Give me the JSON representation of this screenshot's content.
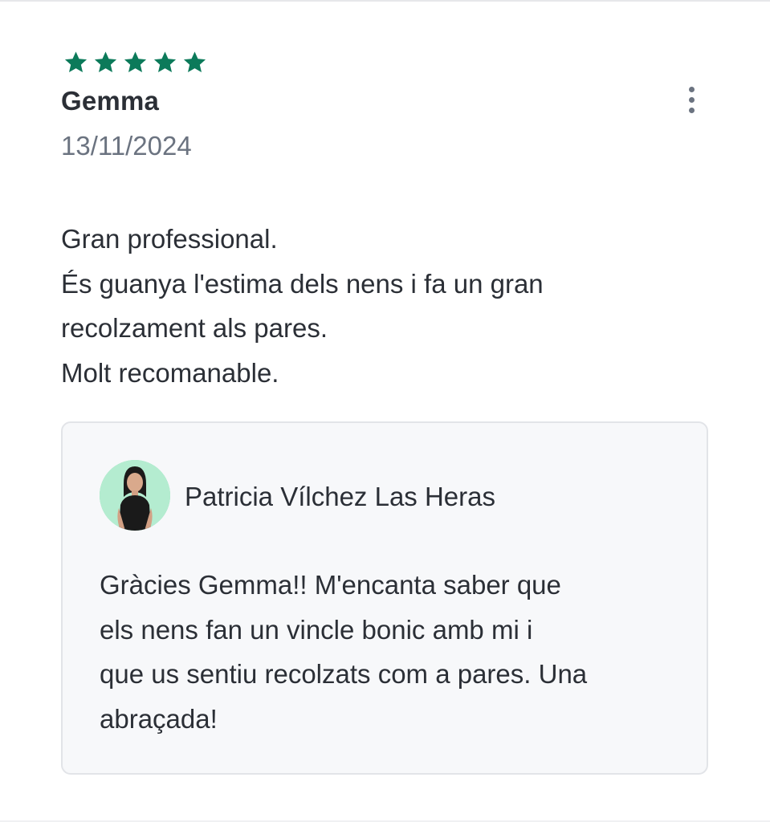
{
  "review": {
    "rating": 5,
    "rating_max": 5,
    "star_color": "#0c7a5a",
    "star_icon": "star-icon",
    "author": "Gemma",
    "date": "13/11/2024",
    "menu_icon": "more-vertical-icon",
    "body_lines": [
      "Gran professional.",
      "És guanya l'estima dels nens i fa un gran",
      "recolzament als pares.",
      "Molt recomanable."
    ]
  },
  "reply": {
    "author": "Patricia Vílchez Las Heras",
    "avatar_icon": "avatar-photo",
    "avatar_bg": "#a8e6c6",
    "body_lines": [
      "Gràcies Gemma!! M'encanta saber que",
      "els nens fan un vincle bonic amb mi i",
      "que us sentiu recolzats com a pares. Una",
      "abraçada!"
    ]
  }
}
